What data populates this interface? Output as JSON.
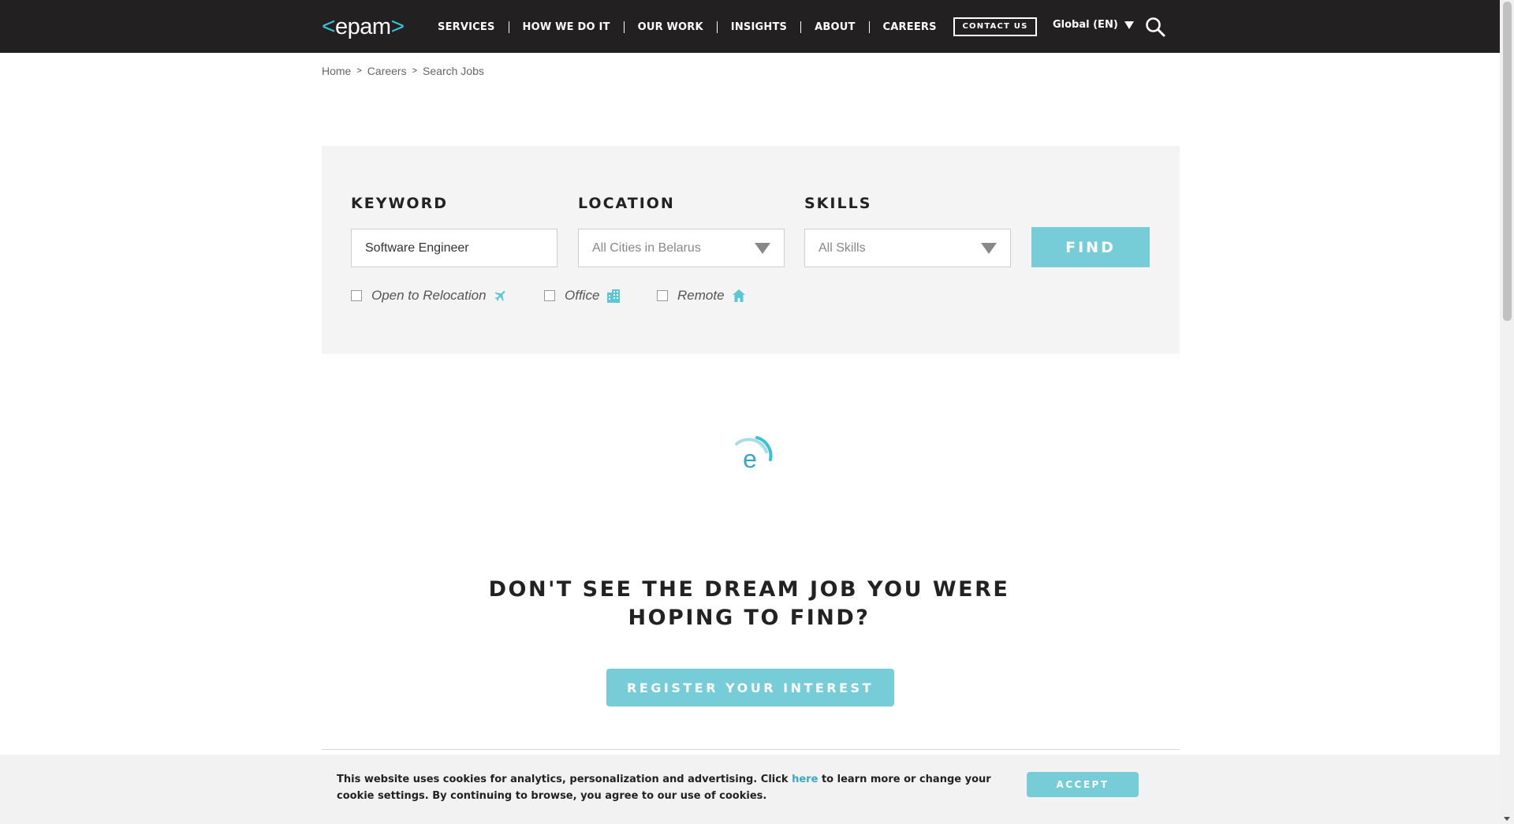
{
  "header": {
    "logo_text": "epam",
    "nav": [
      "SERVICES",
      "HOW WE DO IT",
      "OUR WORK",
      "INSIGHTS",
      "ABOUT",
      "CAREERS"
    ],
    "contact_label": "CONTACT US",
    "region_label": "Global (EN)",
    "icons": {
      "search": "search-icon",
      "region": "triangle-down-icon"
    }
  },
  "breadcrumb": {
    "items": [
      "Home",
      "Careers",
      "Search Jobs"
    ],
    "separator": ">"
  },
  "search": {
    "keyword": {
      "label": "KEYWORD",
      "value": "Software Engineer"
    },
    "location": {
      "label": "LOCATION",
      "value": "All Cities in Belarus"
    },
    "skills": {
      "label": "SKILLS",
      "value": "All Skills"
    },
    "find_label": "FIND",
    "filters": {
      "relocation": {
        "label": "Open to Relocation",
        "icon": "airplane-icon",
        "checked": false
      },
      "office": {
        "label": "Office",
        "icon": "building-icon",
        "checked": false
      },
      "remote": {
        "label": "Remote",
        "icon": "house-icon",
        "checked": false
      }
    }
  },
  "loader": {
    "glyph": "e",
    "icon": "loading-spinner-icon"
  },
  "dream": {
    "heading_line1": "DON'T SEE THE DREAM JOB YOU WERE",
    "heading_line2": "HOPING TO FIND?",
    "register_label": "REGISTER YOUR INTEREST"
  },
  "cookie": {
    "text_before": "This website uses cookies for analytics, personalization and advertising. Click ",
    "link_text": "here",
    "text_after": " to learn more or change your cookie settings. By continuing to browse, you agree to our use of cookies.",
    "accept_label": "ACCEPT"
  },
  "colors": {
    "header_bg": "#222020",
    "accent": "#76cdd8",
    "brand_cyan": "#39c2d7",
    "panel_bg": "#f4f4f4",
    "cookie_bg": "#f2f2f2"
  }
}
